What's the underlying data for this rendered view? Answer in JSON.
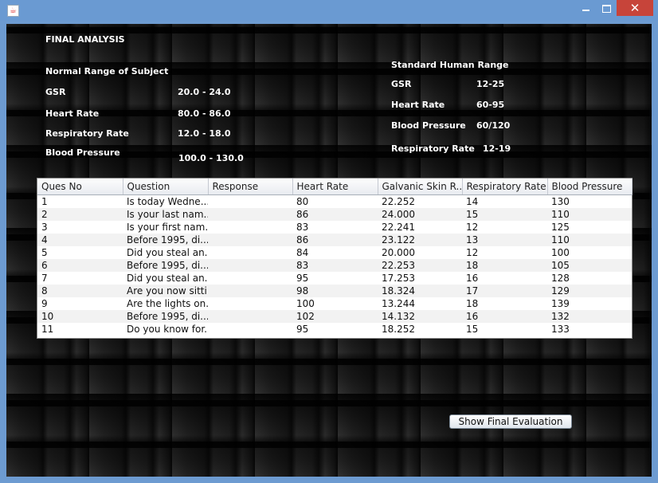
{
  "analysis_title": "FINAL ANALYSIS",
  "subject_range": {
    "heading": "Normal Range of Subject",
    "items": [
      {
        "label": "GSR",
        "value": "20.0 - 24.0"
      },
      {
        "label": "Heart Rate",
        "value": "80.0 - 86.0"
      },
      {
        "label": "Respiratory Rate",
        "value": "12.0 - 18.0"
      },
      {
        "label": "Blood Pressure",
        "value": "100.0 - 130.0"
      }
    ]
  },
  "standard_range": {
    "heading": "Standard Human Range",
    "items": [
      {
        "label": "GSR",
        "value": "12-25"
      },
      {
        "label": "Heart Rate",
        "value": "60-95"
      },
      {
        "label": "Blood Pressure",
        "value": "60/120"
      },
      {
        "label": "Respiratory Rate",
        "value": "12-19"
      }
    ]
  },
  "table": {
    "columns": [
      "Ques No",
      "Question",
      "Response",
      "Heart Rate",
      "Galvanic Skin R...",
      "Respiratory Rate",
      "Blood Pressure"
    ],
    "rows": [
      [
        "1",
        "Is today Wedne...",
        "",
        "80",
        "22.252",
        "14",
        "130"
      ],
      [
        "2",
        "Is your last nam...",
        "",
        "86",
        "24.000",
        "15",
        "110"
      ],
      [
        "3",
        "Is your first nam...",
        "",
        "83",
        "22.241",
        "12",
        "125"
      ],
      [
        "4",
        "Before 1995, di...",
        "",
        "86",
        "23.122",
        "13",
        "110"
      ],
      [
        "5",
        "Did you steal an...",
        "",
        "84",
        "20.000",
        "12",
        "100"
      ],
      [
        "6",
        "Before 1995, di...",
        "",
        "83",
        "22.253",
        "18",
        "105"
      ],
      [
        "7",
        "Did you steal an...",
        "",
        "95",
        "17.253",
        "16",
        "128"
      ],
      [
        "8",
        "Are you now sitti...",
        "",
        "98",
        "18.324",
        "17",
        "129"
      ],
      [
        "9",
        "Are the lights on...",
        "",
        "100",
        "13.244",
        "18",
        "139"
      ],
      [
        "10",
        "Before 1995, di...",
        "",
        "102",
        "14.132",
        "16",
        "132"
      ],
      [
        "11",
        "Do you know for...",
        "",
        "95",
        "18.252",
        "15",
        "133"
      ]
    ]
  },
  "buttons": {
    "show_final_evaluation": "Show Final Evaluation",
    "close_glyph": "✕"
  }
}
